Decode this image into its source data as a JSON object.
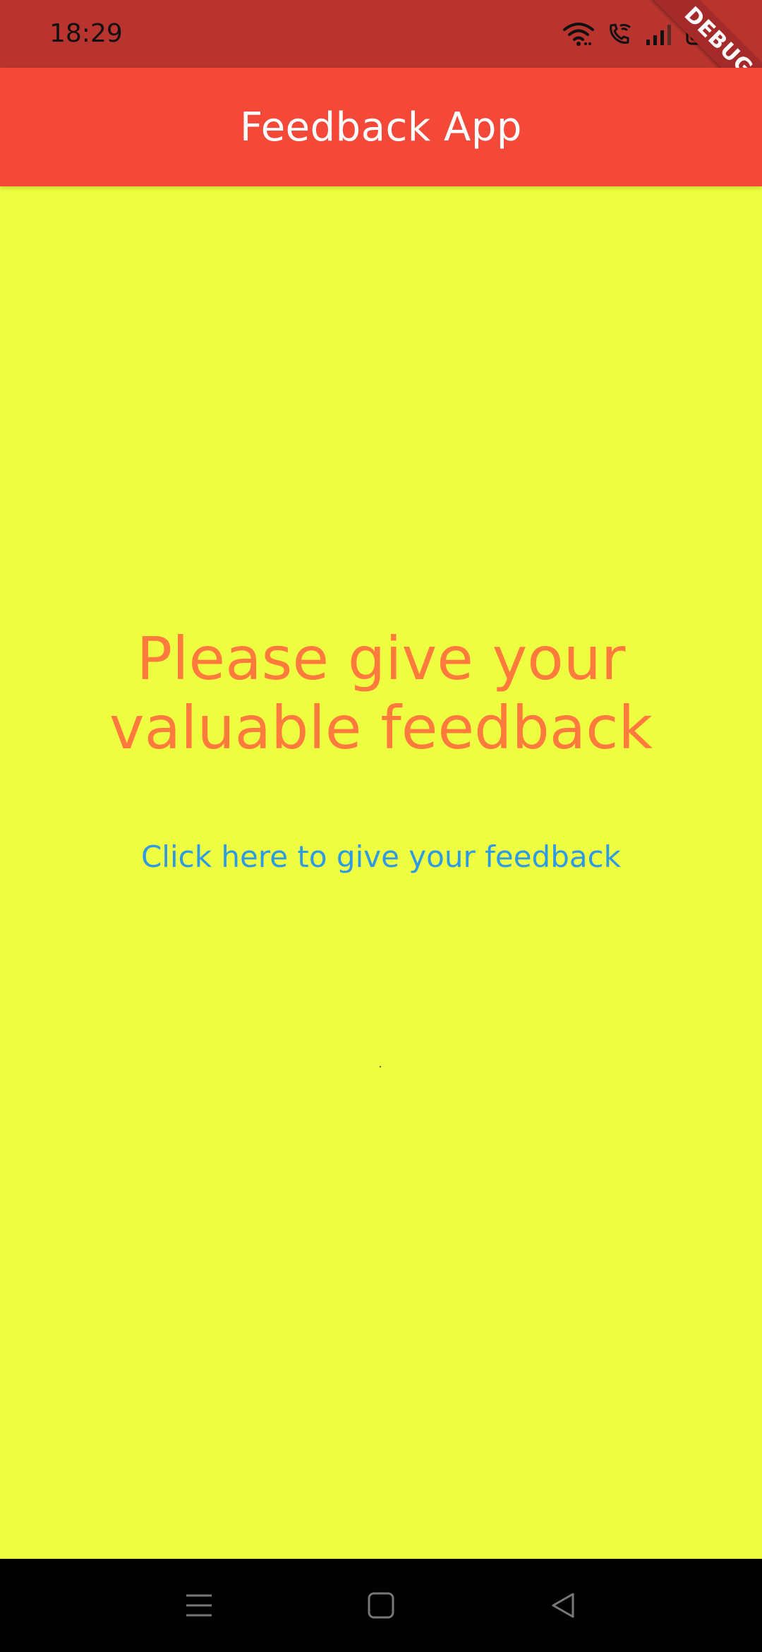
{
  "status_bar": {
    "time": "18:29",
    "icons": [
      "wifi-icon",
      "wifi-call-icon",
      "signal-icon",
      "battery-icon"
    ]
  },
  "debug_banner": {
    "label": "DEBUG"
  },
  "app_bar": {
    "title": "Feedback App"
  },
  "main": {
    "headline": "Please give your valuable feedback",
    "link_label": "Click here to give your feedback"
  },
  "nav_bar": {
    "buttons": [
      "menu-icon",
      "home-icon",
      "back-icon"
    ]
  },
  "colors": {
    "status_bar_bg": "#B9342E",
    "app_bar_bg": "#F44839",
    "page_bg": "#EEFF41",
    "headline": "#FF7A3D",
    "link": "#2E9AE6",
    "nav_bar_bg": "#000000"
  }
}
